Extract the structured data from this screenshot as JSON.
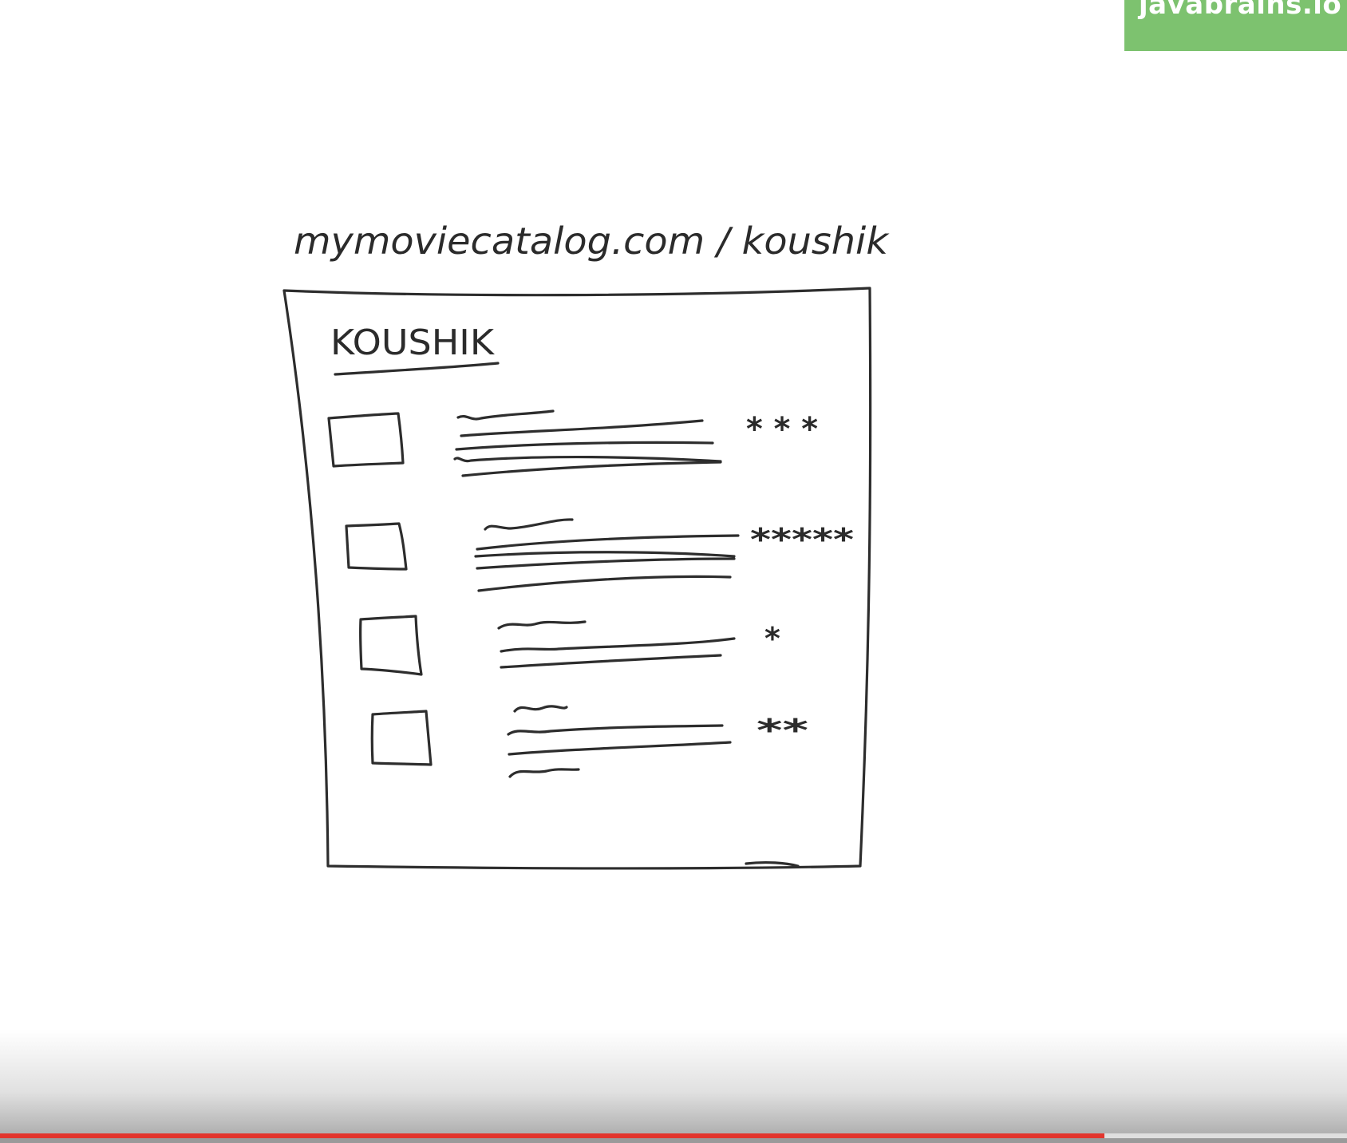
{
  "brand": {
    "name": "javabrains.io",
    "color": "#7dc26f"
  },
  "sketch": {
    "url_caption": "mymoviecatalog.com / koushik",
    "page_heading": "KOUSHIK",
    "movies": [
      {
        "rating_stars": 3
      },
      {
        "rating_stars": 5
      },
      {
        "rating_stars": 1
      },
      {
        "rating_stars": 2
      }
    ]
  },
  "video_player": {
    "progress": 0.82,
    "progress_color": "#e3352d"
  }
}
